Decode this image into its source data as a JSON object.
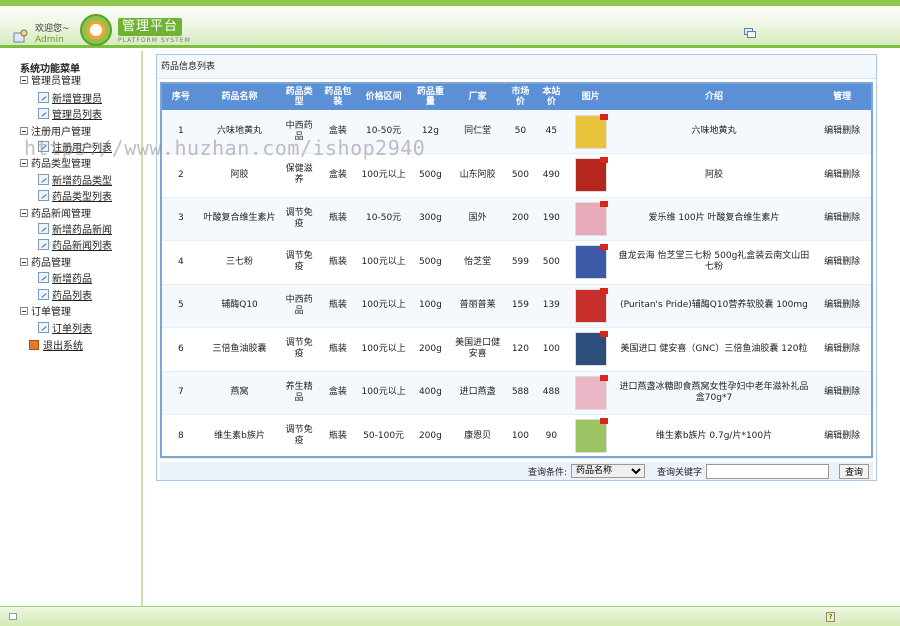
{
  "header": {
    "welcome_label": "欢迎您~",
    "user_name": "Admin",
    "logo_text": "管理平台",
    "logo_subtext": "PLATFORM SYSTEM"
  },
  "sidebar": {
    "root_label": "系统功能菜单",
    "groups": [
      {
        "label": "管理员管理",
        "items": [
          "新增管理员",
          "管理员列表"
        ]
      },
      {
        "label": "注册用户管理",
        "items": [
          "注册用户列表"
        ]
      },
      {
        "label": "药品类型管理",
        "items": [
          "新增药品类型",
          "药品类型列表"
        ]
      },
      {
        "label": "药品新闻管理",
        "items": [
          "新增药品新闻",
          "药品新闻列表"
        ]
      },
      {
        "label": "药品管理",
        "items": [
          "新增药品",
          "药品列表"
        ]
      },
      {
        "label": "订单管理",
        "items": [
          "订单列表"
        ]
      }
    ],
    "exit_label": "退出系统"
  },
  "panel": {
    "title": "药品信息列表"
  },
  "table": {
    "headers": [
      "序号",
      "药品名称",
      "药品类型",
      "药品包装",
      "价格区间",
      "药品重量",
      "厂家",
      "市场价",
      "本站价",
      "图片",
      "介绍",
      "管理"
    ],
    "rows": [
      [
        "1",
        "六味地黄丸",
        "中西药品",
        "盒装",
        "10-50元",
        "12g",
        "同仁堂",
        "50",
        "45",
        "",
        "六味地黄丸",
        "编辑|删除"
      ],
      [
        "2",
        "阿胶",
        "保健滋养",
        "盒装",
        "100元以上",
        "500g",
        "山东阿胶",
        "500",
        "490",
        "",
        "阿胶",
        "编辑|删除"
      ],
      [
        "3",
        "叶酸复合维生素片",
        "调节免疫",
        "瓶装",
        "10-50元",
        "300g",
        "国外",
        "200",
        "190",
        "",
        "爱乐维 100片 叶酸复合维生素片",
        "编辑|删除"
      ],
      [
        "4",
        "三七粉",
        "调节免疫",
        "瓶装",
        "100元以上",
        "500g",
        "怡芝堂",
        "599",
        "500",
        "",
        "盘龙云海 怡芝堂三七粉 500g礼盒装云南文山田七粉",
        "编辑|删除"
      ],
      [
        "5",
        "辅酶Q10",
        "中西药品",
        "瓶装",
        "100元以上",
        "100g",
        "普丽普莱",
        "159",
        "139",
        "",
        "(Puritan's Pride)辅酶Q10营养软胶囊 100mg",
        "编辑|删除"
      ],
      [
        "6",
        "三倍鱼油胶囊",
        "调节免疫",
        "瓶装",
        "100元以上",
        "200g",
        "美国进口健安喜",
        "120",
        "100",
        "",
        "美国进口 健安喜（GNC）三倍鱼油胶囊 120粒",
        "编辑|删除"
      ],
      [
        "7",
        "燕窝",
        "养生精品",
        "盒装",
        "100元以上",
        "400g",
        "进口燕盏",
        "588",
        "488",
        "",
        "进口燕盏冰糖即食燕窝女性孕妇中老年滋补礼品盒70g*7",
        "编辑|删除"
      ],
      [
        "8",
        "维生素b族片",
        "调节免疫",
        "瓶装",
        "50-100元",
        "200g",
        "康恩贝",
        "100",
        "90",
        "",
        "维生素b族片 0.7g/片*100片",
        "编辑|删除"
      ]
    ],
    "thumb_colors": [
      "#e9c33b",
      "#b5271e",
      "#e8a9b9",
      "#3d5aa8",
      "#c7302a",
      "#2b4e7a",
      "#e9b7c6",
      "#9dc462"
    ]
  },
  "search": {
    "condition_label": "查询条件:",
    "condition_value": "药品名称",
    "keyword_label": "查询关键字",
    "keyword_value": "",
    "submit_label": "查询"
  },
  "watermark": "https://www.huzhan.com/ishop2940"
}
